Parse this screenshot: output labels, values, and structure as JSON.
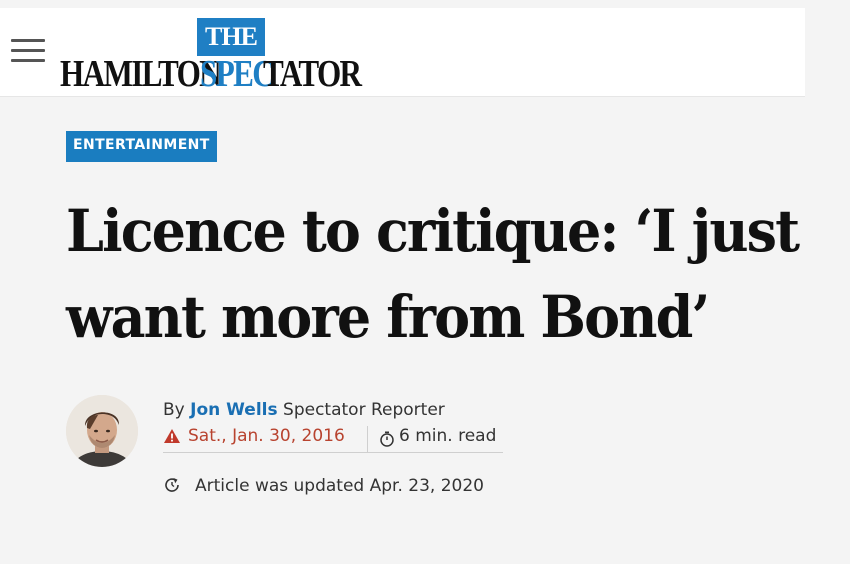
{
  "header": {
    "menu_icon": "hamburger-menu-icon",
    "logo": {
      "the": "THE",
      "word1": "HAMILTON",
      "word2": "SPEC",
      "word3": "TATOR",
      "brand_color": "#1f7fc4"
    }
  },
  "article": {
    "category": "ENTERTAINMENT",
    "category_color": "#1a7dc0",
    "headline_line1": "Licence to critique: ‘I just",
    "headline_line2": "want more from Bond’",
    "byline": {
      "by": "By",
      "author": "Jon Wells",
      "role": "Spectator Reporter"
    },
    "date": "Sat., Jan. 30, 2016",
    "date_icon": "warning-icon",
    "date_color": "#c0392b",
    "read_time": "6 min. read",
    "read_icon": "stopwatch-icon",
    "updated_icon": "refresh-icon",
    "updated": "Article was updated Apr. 23, 2020"
  }
}
